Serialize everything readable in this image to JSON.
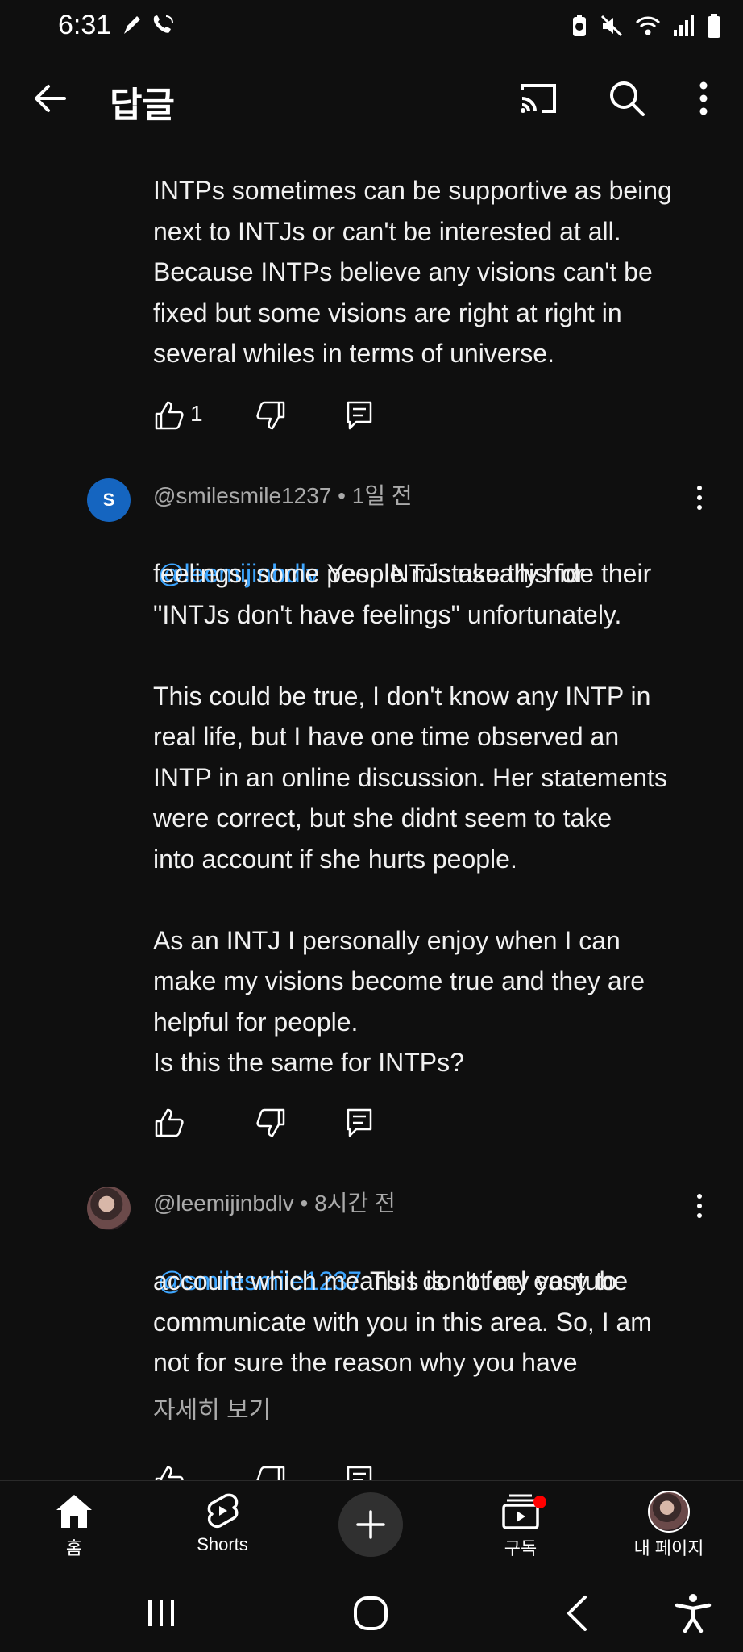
{
  "status_bar": {
    "time": "6:31",
    "left_icons": [
      "pen-icon",
      "wifi-call-icon"
    ],
    "right_icons": [
      "battery-saver-icon",
      "mute-icon",
      "wifi-icon",
      "signal-icon",
      "battery-icon"
    ]
  },
  "app_bar": {
    "title": "답글",
    "icons": [
      "back-arrow-icon",
      "cast-icon",
      "search-icon",
      "more-vertical-icon"
    ]
  },
  "comments": [
    {
      "text": "INTPs sometimes can be supportive as being\nnext to INTJs or can't be interested at all.\nBecause INTPs believe any visions can't be\nfixed but some visions are right at right in\nseveral whiles in terms of universe.",
      "likes": "1"
    },
    {
      "avatar_letter": "S",
      "author": "@smilesmile1237",
      "time": "1일 전",
      "mention": "@leemijinbdlv",
      "text_first": "Yes, INTJs usually hide their",
      "text": "feelings, some people mistake this for\n\"INTJs don't have feelings\" unfortunately.\n\nThis could be true, I don't know any INTP in\nreal life, but I have one time observed an\nINTP in an online discussion. Her statements\nwere correct, but she didnt seem to take\ninto account if she hurts people.\n\nAs an INTJ I personally enjoy when I can\nmake my visions become true and they are\nhelpful for people.\nIs this the same for INTPs?"
    },
    {
      "author": "@leemijinbdlv",
      "time": "8시간 전",
      "mention": "@smilesmile1237",
      "text_first": "This is not my youtube",
      "text": "account which means I don't feel easy to\ncommunicate with you in this area. So, I am\nnot for sure the reason why you have",
      "read_more": "자세히 보기"
    }
  ],
  "bottom_nav": {
    "items": [
      {
        "label": "홈",
        "icon": "home-icon"
      },
      {
        "label": "Shorts",
        "icon": "shorts-icon"
      },
      {
        "label": "",
        "icon": "create-plus-icon"
      },
      {
        "label": "구독",
        "icon": "subscriptions-icon"
      },
      {
        "label": "내 페이지",
        "icon": "profile-avatar"
      }
    ]
  },
  "colors": {
    "background": "#0f0f0f",
    "mention": "#3ea6ff",
    "meta": "#aaaaaa",
    "notification": "#ff0000"
  }
}
